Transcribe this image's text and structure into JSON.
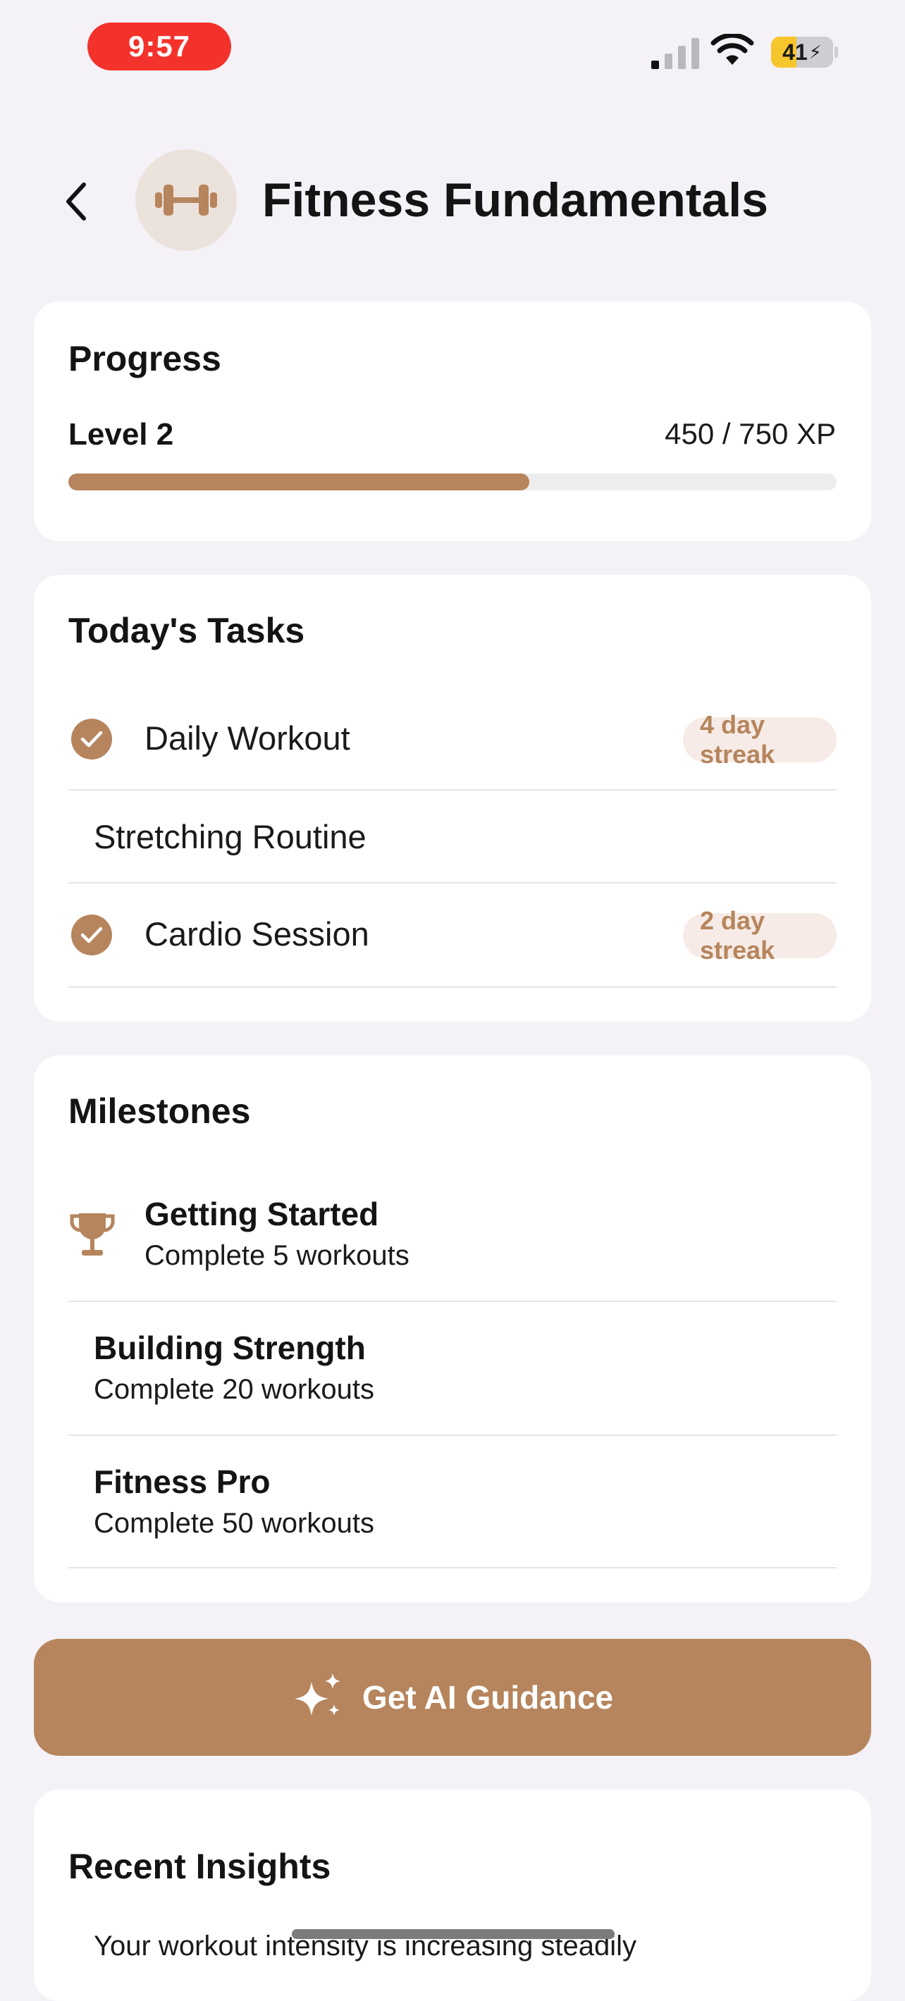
{
  "status_bar": {
    "time": "9:57",
    "battery_percent": "41",
    "battery_level": 0.41
  },
  "header": {
    "title": "Fitness Fundamentals",
    "icon": "dumbbell-icon",
    "back_icon": "chevron-left-icon"
  },
  "progress": {
    "title": "Progress",
    "level": "Level 2",
    "xp_text": "450 / 750 XP",
    "xp_current": 450,
    "xp_total": 750
  },
  "tasks": {
    "title": "Today's Tasks",
    "items": [
      {
        "label": "Daily Workout",
        "completed": true,
        "streak": "4 day streak"
      },
      {
        "label": "Stretching Routine",
        "completed": false,
        "streak": ""
      },
      {
        "label": "Cardio Session",
        "completed": true,
        "streak": "2 day streak"
      }
    ]
  },
  "milestones": {
    "title": "Milestones",
    "items": [
      {
        "title": "Getting Started",
        "desc": "Complete 5 workouts",
        "achieved": true
      },
      {
        "title": "Building Strength",
        "desc": "Complete 20 workouts",
        "achieved": false
      },
      {
        "title": "Fitness Pro",
        "desc": "Complete 50 workouts",
        "achieved": false
      }
    ]
  },
  "guidance_button": {
    "label": "Get AI Guidance",
    "icon": "sparkles-icon"
  },
  "insights": {
    "title": "Recent Insights",
    "first_item": "Your workout intensity is increasing steadily"
  },
  "colors": {
    "accent": "#b6855d",
    "accent_light": "#f6ebe6",
    "background": "#f4f2f7",
    "status_time": "#f4322c"
  }
}
